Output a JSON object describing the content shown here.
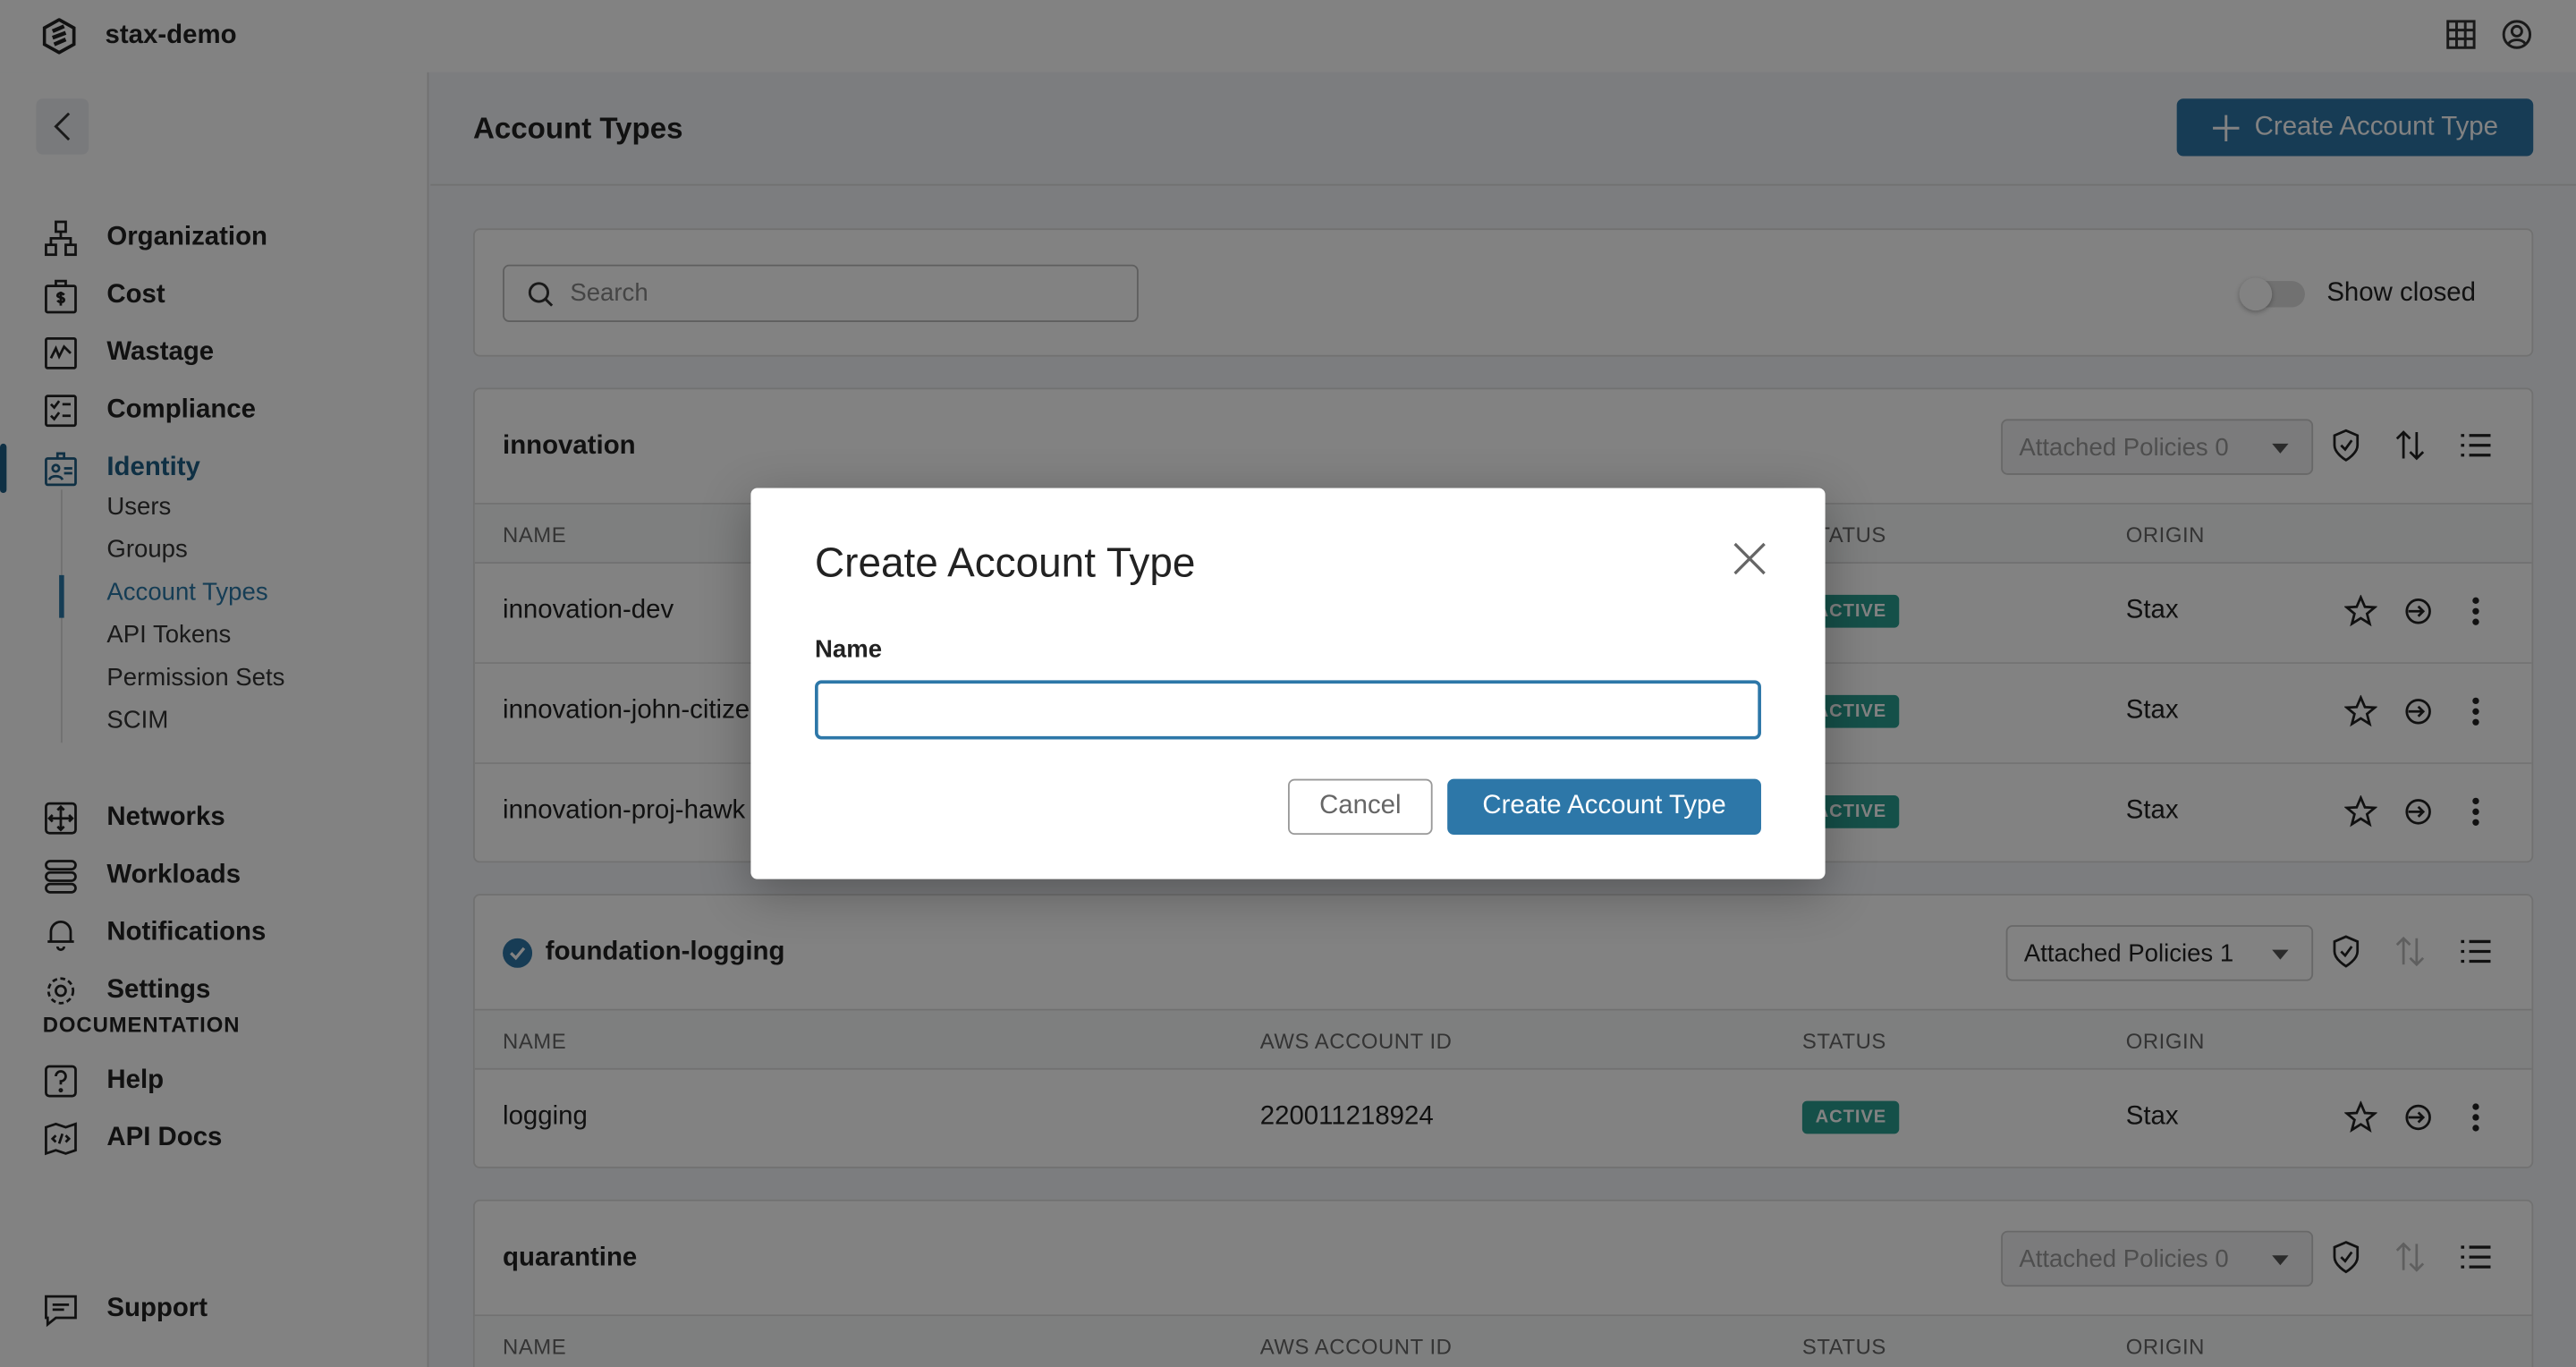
{
  "app": {
    "org": "stax-demo"
  },
  "sidebar": {
    "items": [
      {
        "label": "Organization",
        "icon": "organization-icon"
      },
      {
        "label": "Cost",
        "icon": "cost-icon"
      },
      {
        "label": "Wastage",
        "icon": "wastage-icon"
      },
      {
        "label": "Compliance",
        "icon": "compliance-icon"
      },
      {
        "label": "Identity",
        "icon": "identity-icon",
        "active": true
      },
      {
        "label": "Networks",
        "icon": "networks-icon"
      },
      {
        "label": "Workloads",
        "icon": "workloads-icon"
      },
      {
        "label": "Notifications",
        "icon": "bell-icon"
      },
      {
        "label": "Settings",
        "icon": "gear-icon"
      }
    ],
    "identity_sub": [
      "Users",
      "Groups",
      "Account Types",
      "API Tokens",
      "Permission Sets",
      "SCIM"
    ],
    "documentation_heading": "DOCUMENTATION",
    "doc_items": [
      "Help",
      "API Docs"
    ],
    "support": "Support"
  },
  "header": {
    "title": "Account Types",
    "create_label": "Create Account Type"
  },
  "filter": {
    "search_placeholder": "Search",
    "show_closed": "Show closed",
    "show_closed_on": false
  },
  "columns": [
    "NAME",
    "AWS ACCOUNT ID",
    "STATUS",
    "ORIGIN"
  ],
  "groups": [
    {
      "name": "innovation",
      "policies": "Attached Policies 0",
      "default": false,
      "rows": [
        {
          "name": "innovation-dev",
          "id": "",
          "status": "ACTIVE",
          "origin": "Stax"
        },
        {
          "name": "innovation-john-citize",
          "id": "",
          "status": "ACTIVE",
          "origin": "Stax"
        },
        {
          "name": "innovation-proj-hawk",
          "id": "",
          "status": "ACTIVE",
          "origin": "Stax"
        }
      ]
    },
    {
      "name": "foundation-logging",
      "policies": "Attached Policies 1",
      "default": true,
      "rows": [
        {
          "name": "logging",
          "id": "220011218924",
          "status": "ACTIVE",
          "origin": "Stax"
        }
      ]
    },
    {
      "name": "quarantine",
      "policies": "Attached Policies 0",
      "default": false,
      "rows": []
    }
  ],
  "modal": {
    "title": "Create Account Type",
    "name_label": "Name",
    "name_value": "",
    "cancel": "Cancel",
    "submit": "Create Account Type"
  },
  "colors": {
    "accent": "#2d77a8",
    "active_badge": "#2a9d8f",
    "identity": "#1f5f85"
  }
}
